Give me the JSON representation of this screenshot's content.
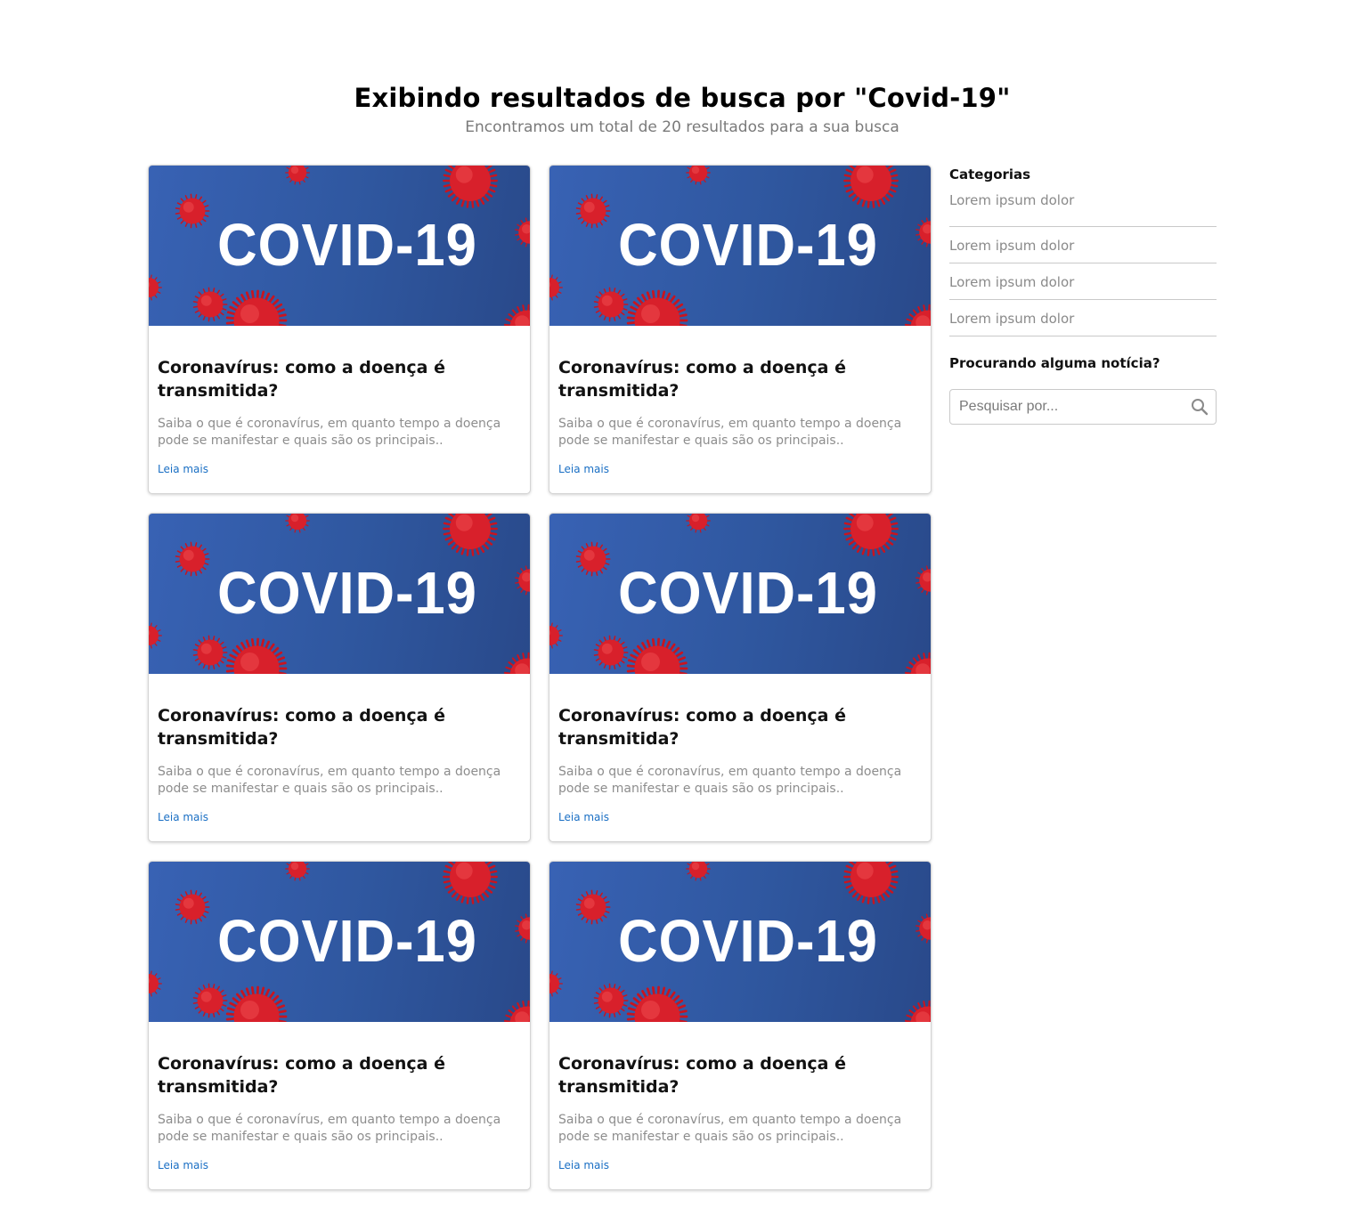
{
  "header": {
    "title": "Exibindo resultados de busca por \"Covid-19\"",
    "subtitle": "Encontramos um total de 20 resultados para a sua busca"
  },
  "cards": [
    {
      "image_text": "COVID-19",
      "title": "Coronavírus: como a doença é transmitida?",
      "excerpt": "Saiba o que é coronavírus, em quanto tempo a doença pode se manifestar e quais são os principais..",
      "link": "Leia mais"
    },
    {
      "image_text": "COVID-19",
      "title": "Coronavírus: como a doença é transmitida?",
      "excerpt": "Saiba o que é coronavírus, em quanto tempo a doença pode se manifestar e quais são os principais..",
      "link": "Leia mais"
    },
    {
      "image_text": "COVID-19",
      "title": "Coronavírus: como a doença é transmitida?",
      "excerpt": "Saiba o que é coronavírus, em quanto tempo a doença pode se manifestar e quais são os principais..",
      "link": "Leia mais"
    },
    {
      "image_text": "COVID-19",
      "title": "Coronavírus: como a doença é transmitida?",
      "excerpt": "Saiba o que é coronavírus, em quanto tempo a doença pode se manifestar e quais são os principais..",
      "link": "Leia mais"
    },
    {
      "image_text": "COVID-19",
      "title": "Coronavírus: como a doença é transmitida?",
      "excerpt": "Saiba o que é coronavírus, em quanto tempo a doença pode se manifestar e quais são os principais..",
      "link": "Leia mais"
    },
    {
      "image_text": "COVID-19",
      "title": "Coronavírus: como a doença é transmitida?",
      "excerpt": "Saiba o que é coronavírus, em quanto tempo a doença pode se manifestar e quais são os principais..",
      "link": "Leia mais"
    }
  ],
  "sidebar": {
    "categories_title": "Categorias",
    "categories": [
      "Lorem ipsum dolor",
      "Lorem ipsum dolor",
      "Lorem ipsum dolor",
      "Lorem ipsum dolor"
    ],
    "search_title": "Procurando alguma notícia?",
    "search": {
      "placeholder": "Pesquisar por...",
      "value": "",
      "icon": "search-icon"
    }
  },
  "colors": {
    "image_blue": "#2f579f",
    "virus_red": "#d8202b",
    "link_blue": "#1a6fc4",
    "muted_text": "#8d8d8d"
  }
}
